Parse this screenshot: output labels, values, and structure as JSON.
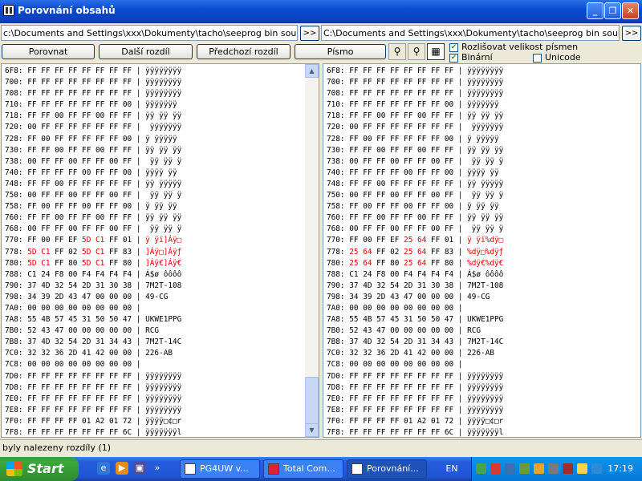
{
  "window": {
    "title": "Porovnání obsahů"
  },
  "paths": {
    "left": "c:\\Documents and Settings\\xxx\\Dokumenty\\tacho\\seeprog bin soubory\\ford",
    "right": "C:\\Documents and Settings\\xxx\\Dokumenty\\tacho\\seeprog bin soubory\\ford",
    "go_label": ">>"
  },
  "toolbar": {
    "compare": "Porovnat",
    "next_diff": "Další rozdíl",
    "prev_diff": "Předchozí rozdíl",
    "font": "Písmo"
  },
  "options": [
    {
      "label": "Rozlišovat velikost písmen",
      "checked": true
    },
    {
      "label": "Binární",
      "checked": true
    },
    {
      "label": "Unicode",
      "checked": false
    }
  ],
  "left_rows": [
    {
      "addr": "6F8:",
      "hex": "FF FF FF FF FF FF FF FF",
      "asc": "ÿÿÿÿÿÿÿÿ"
    },
    {
      "addr": "700:",
      "hex": "FF FF FF FF FF FF FF FF",
      "asc": "ÿÿÿÿÿÿÿÿ"
    },
    {
      "addr": "708:",
      "hex": "FF FF FF FF FF FF FF FF",
      "asc": "ÿÿÿÿÿÿÿÿ"
    },
    {
      "addr": "710:",
      "hex": "FF FF FF FF FF FF FF 00",
      "asc": "ÿÿÿÿÿÿÿ"
    },
    {
      "addr": "718:",
      "hex": "FF FF 00 FF FF 00 FF FF",
      "asc": "ÿÿ ÿÿ ÿÿ"
    },
    {
      "addr": "720:",
      "hex": "00 FF FF FF FF FF FF FF",
      "asc": " ÿÿÿÿÿÿÿ"
    },
    {
      "addr": "728:",
      "hex": "FF 00 FF FF FF FF FF 00",
      "asc": "ÿ ÿÿÿÿÿ"
    },
    {
      "addr": "730:",
      "hex": "FF FF 00 FF FF 00 FF FF",
      "asc": "ÿÿ ÿÿ ÿÿ"
    },
    {
      "addr": "738:",
      "hex": "00 FF FF 00 FF FF 00 FF",
      "asc": " ÿÿ ÿÿ ÿ"
    },
    {
      "addr": "740:",
      "hex": "FF FF FF FF 00 FF FF 00",
      "asc": "ÿÿÿÿ ÿÿ"
    },
    {
      "addr": "748:",
      "hex": "FF FF 00 FF FF FF FF FF",
      "asc": "ÿÿ ÿÿÿÿÿ"
    },
    {
      "addr": "750:",
      "hex": "00 FF FF 00 FF FF 00 FF",
      "asc": " ÿÿ ÿÿ ÿ"
    },
    {
      "addr": "758:",
      "hex": "FF 00 FF FF 00 FF FF 00",
      "asc": "ÿ ÿÿ ÿÿ"
    },
    {
      "addr": "760:",
      "hex": "FF FF 00 FF FF 00 FF FF",
      "asc": "ÿÿ ÿÿ ÿÿ"
    },
    {
      "addr": "768:",
      "hex": "00 FF FF 00 FF FF 00 FF",
      "asc": " ÿÿ ÿÿ ÿ"
    },
    {
      "addr": "770:",
      "hex": "FF 00 FF EF 5D C1 FF 01",
      "asc": "ÿ ÿï]Áÿ□",
      "diff": [
        4,
        5
      ]
    },
    {
      "addr": "778:",
      "hex": "5D C1 FF 02 5D C1 FF 83",
      "asc": "]Áÿ□]Áÿƒ",
      "diff": [
        0,
        1,
        4,
        5
      ]
    },
    {
      "addr": "780:",
      "hex": "5D C1 FF 80 5D C1 FF 80",
      "asc": "]Áÿ€]Áÿ€",
      "diff": [
        0,
        1,
        4,
        5
      ]
    },
    {
      "addr": "788:",
      "hex": "C1 24 F8 00 F4 F4 F4 F4",
      "asc": "Á$ø ôôôô"
    },
    {
      "addr": "790:",
      "hex": "37 4D 32 54 2D 31 30 38",
      "asc": "7M2T-108"
    },
    {
      "addr": "798:",
      "hex": "34 39 2D 43 47 00 00 00",
      "asc": "49-CG"
    },
    {
      "addr": "7A0:",
      "hex": "00 00 00 00 00 00 00 00",
      "asc": ""
    },
    {
      "addr": "7A8:",
      "hex": "55 4B 57 45 31 50 50 47",
      "asc": "UKWE1PPG"
    },
    {
      "addr": "7B0:",
      "hex": "52 43 47 00 00 00 00 00",
      "asc": "RCG"
    },
    {
      "addr": "7B8:",
      "hex": "37 4D 32 54 2D 31 34 43",
      "asc": "7M2T-14C"
    },
    {
      "addr": "7C0:",
      "hex": "32 32 36 2D 41 42 00 00",
      "asc": "226-AB"
    },
    {
      "addr": "7C8:",
      "hex": "00 00 00 00 00 00 00 00",
      "asc": ""
    },
    {
      "addr": "7D0:",
      "hex": "FF FF FF FF FF FF FF FF",
      "asc": "ÿÿÿÿÿÿÿÿ"
    },
    {
      "addr": "7D8:",
      "hex": "FF FF FF FF FF FF FF FF",
      "asc": "ÿÿÿÿÿÿÿÿ"
    },
    {
      "addr": "7E0:",
      "hex": "FF FF FF FF FF FF FF FF",
      "asc": "ÿÿÿÿÿÿÿÿ"
    },
    {
      "addr": "7E8:",
      "hex": "FF FF FF FF FF FF FF FF",
      "asc": "ÿÿÿÿÿÿÿÿ"
    },
    {
      "addr": "7F0:",
      "hex": "FF FF FF FF 01 A2 01 72",
      "asc": "ÿÿÿÿ□¢□r"
    },
    {
      "addr": "7F8:",
      "hex": "FF FF FF FF FF FF FF 6C",
      "asc": "ÿÿÿÿÿÿÿl"
    }
  ],
  "right_rows": [
    {
      "addr": "6F8:",
      "hex": "FF FF FF FF FF FF FF FF",
      "asc": "ÿÿÿÿÿÿÿÿ"
    },
    {
      "addr": "700:",
      "hex": "FF FF FF FF FF FF FF FF",
      "asc": "ÿÿÿÿÿÿÿÿ"
    },
    {
      "addr": "708:",
      "hex": "FF FF FF FF FF FF FF FF",
      "asc": "ÿÿÿÿÿÿÿÿ"
    },
    {
      "addr": "710:",
      "hex": "FF FF FF FF FF FF FF 00",
      "asc": "ÿÿÿÿÿÿÿ"
    },
    {
      "addr": "718:",
      "hex": "FF FF 00 FF FF 00 FF FF",
      "asc": "ÿÿ ÿÿ ÿÿ"
    },
    {
      "addr": "720:",
      "hex": "00 FF FF FF FF FF FF FF",
      "asc": " ÿÿÿÿÿÿÿ"
    },
    {
      "addr": "728:",
      "hex": "FF 00 FF FF FF FF FF 00",
      "asc": "ÿ ÿÿÿÿÿ"
    },
    {
      "addr": "730:",
      "hex": "FF FF 00 FF FF 00 FF FF",
      "asc": "ÿÿ ÿÿ ÿÿ"
    },
    {
      "addr": "738:",
      "hex": "00 FF FF 00 FF FF 00 FF",
      "asc": " ÿÿ ÿÿ ÿ"
    },
    {
      "addr": "740:",
      "hex": "FF FF FF FF 00 FF FF 00",
      "asc": "ÿÿÿÿ ÿÿ"
    },
    {
      "addr": "748:",
      "hex": "FF FF 00 FF FF FF FF FF",
      "asc": "ÿÿ ÿÿÿÿÿ"
    },
    {
      "addr": "750:",
      "hex": "00 FF FF 00 FF FF 00 FF",
      "asc": " ÿÿ ÿÿ ÿ"
    },
    {
      "addr": "758:",
      "hex": "FF 00 FF FF 00 FF FF 00",
      "asc": "ÿ ÿÿ ÿÿ"
    },
    {
      "addr": "760:",
      "hex": "FF FF 00 FF FF 00 FF FF",
      "asc": "ÿÿ ÿÿ ÿÿ"
    },
    {
      "addr": "768:",
      "hex": "00 FF FF 00 FF FF 00 FF",
      "asc": " ÿÿ ÿÿ ÿ"
    },
    {
      "addr": "770:",
      "hex": "FF 00 FF EF 25 64 FF 01",
      "asc": "ÿ ÿï%dÿ□",
      "diff": [
        4,
        5
      ]
    },
    {
      "addr": "778:",
      "hex": "25 64 FF 02 25 64 FF 83",
      "asc": "%dÿ□%dÿƒ",
      "diff": [
        0,
        1,
        4,
        5
      ]
    },
    {
      "addr": "780:",
      "hex": "25 64 FF 80 25 64 FF 80",
      "asc": "%dÿ€%dÿ€",
      "diff": [
        0,
        1,
        4,
        5
      ]
    },
    {
      "addr": "788:",
      "hex": "C1 24 F8 00 F4 F4 F4 F4",
      "asc": "Á$ø ôôôô"
    },
    {
      "addr": "790:",
      "hex": "37 4D 32 54 2D 31 30 38",
      "asc": "7M2T-108"
    },
    {
      "addr": "798:",
      "hex": "34 39 2D 43 47 00 00 00",
      "asc": "49-CG"
    },
    {
      "addr": "7A0:",
      "hex": "00 00 00 00 00 00 00 00",
      "asc": ""
    },
    {
      "addr": "7A8:",
      "hex": "55 4B 57 45 31 50 50 47",
      "asc": "UKWE1PPG"
    },
    {
      "addr": "7B0:",
      "hex": "52 43 47 00 00 00 00 00",
      "asc": "RCG"
    },
    {
      "addr": "7B8:",
      "hex": "37 4D 32 54 2D 31 34 43",
      "asc": "7M2T-14C"
    },
    {
      "addr": "7C0:",
      "hex": "32 32 36 2D 41 42 00 00",
      "asc": "226-AB"
    },
    {
      "addr": "7C8:",
      "hex": "00 00 00 00 00 00 00 00",
      "asc": ""
    },
    {
      "addr": "7D0:",
      "hex": "FF FF FF FF FF FF FF FF",
      "asc": "ÿÿÿÿÿÿÿÿ"
    },
    {
      "addr": "7D8:",
      "hex": "FF FF FF FF FF FF FF FF",
      "asc": "ÿÿÿÿÿÿÿÿ"
    },
    {
      "addr": "7E0:",
      "hex": "FF FF FF FF FF FF FF FF",
      "asc": "ÿÿÿÿÿÿÿÿ"
    },
    {
      "addr": "7E8:",
      "hex": "FF FF FF FF FF FF FF FF",
      "asc": "ÿÿÿÿÿÿÿÿ"
    },
    {
      "addr": "7F0:",
      "hex": "FF FF FF FF 01 A2 01 72",
      "asc": "ÿÿÿÿ□¢□r"
    },
    {
      "addr": "7F8:",
      "hex": "FF FF FF FF FF FF FF 6C",
      "asc": "ÿÿÿÿÿÿÿl"
    }
  ],
  "status": "byly nalezeny rozdíly (1)",
  "taskbar": {
    "start": "Start",
    "tasks": [
      "PG4UW v...",
      "Total Com...",
      "Porovnání..."
    ],
    "quicklaunch_more": "»",
    "lang": "EN",
    "clock": "17:19"
  },
  "colors": {
    "diff": "#E00000",
    "titlebar": "#0A4BD0",
    "taskbar": "#245DDB",
    "start": "#3AA83A"
  }
}
